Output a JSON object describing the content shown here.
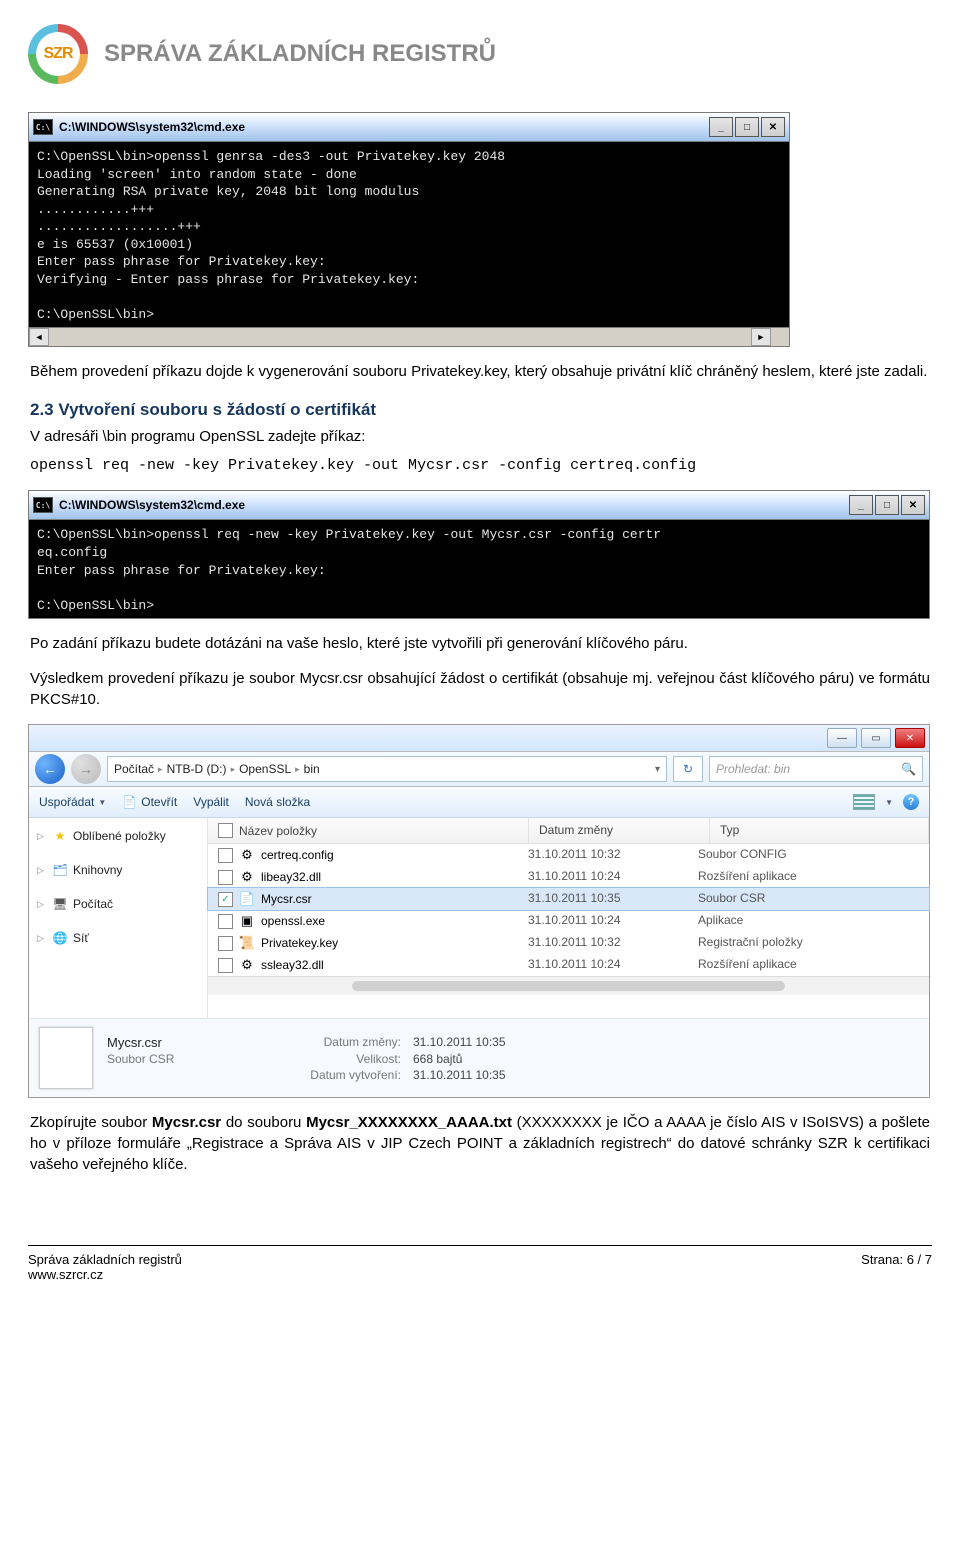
{
  "header": {
    "logo_text": "SZR",
    "title": "SPRÁVA ZÁKLADNÍCH REGISTRŮ"
  },
  "cmd1": {
    "title": "C:\\WINDOWS\\system32\\cmd.exe",
    "icon_label": "C:\\",
    "body": "C:\\OpenSSL\\bin>openssl genrsa -des3 -out Privatekey.key 2048\nLoading 'screen' into random state - done\nGenerating RSA private key, 2048 bit long modulus\n............+++\n..................+++\ne is 65537 (0x10001)\nEnter pass phrase for Privatekey.key:\nVerifying - Enter pass phrase for Privatekey.key:\n\nC:\\OpenSSL\\bin>"
  },
  "para1": "Během provedení příkazu dojde k vygenerování souboru Privatekey.key, který obsahuje privátní klíč chráněný heslem, které jste zadali.",
  "section23": {
    "heading": "2.3 Vytvoření souboru s žádostí o certifikát",
    "line1": "V adresáři \\bin programu OpenSSL zadejte příkaz:",
    "cmdline": "openssl req -new -key Privatekey.key -out Mycsr.csr -config certreq.config"
  },
  "cmd2": {
    "title": "C:\\WINDOWS\\system32\\cmd.exe",
    "icon_label": "C:\\",
    "body": "C:\\OpenSSL\\bin>openssl req -new -key Privatekey.key -out Mycsr.csr -config certr\neq.config\nEnter pass phrase for Privatekey.key:\n\nC:\\OpenSSL\\bin>"
  },
  "para2": "Po zadání příkazu budete dotázáni na vaše heslo, které jste vytvořili při generování klíčového páru.",
  "para3": "Výsledkem provedení příkazu je soubor Mycsr.csr obsahující žádost o certifikát (obsahuje mj. veřejnou část klíčového páru) ve formátu PKCS#10.",
  "explorer": {
    "breadcrumbs": [
      "Počítač",
      "NTB-D (D:)",
      "OpenSSL",
      "bin"
    ],
    "search_placeholder": "Prohledat: bin",
    "toolbar": {
      "organize": "Uspořádat",
      "open": "Otevřít",
      "burn": "Vypálit",
      "newfolder": "Nová složka"
    },
    "sidebar": {
      "favorites": "Oblíbené položky",
      "libraries": "Knihovny",
      "computer": "Počítač",
      "network": "Síť"
    },
    "columns": {
      "name": "Název položky",
      "date": "Datum změny",
      "type": "Typ"
    },
    "rows": [
      {
        "name": "certreq.config",
        "date": "31.10.2011 10:32",
        "type": "Soubor CONFIG",
        "icon": "⚙",
        "selected": false
      },
      {
        "name": "libeay32.dll",
        "date": "31.10.2011 10:24",
        "type": "Rozšíření aplikace",
        "icon": "⚙",
        "selected": false
      },
      {
        "name": "Mycsr.csr",
        "date": "31.10.2011 10:35",
        "type": "Soubor CSR",
        "icon": "📄",
        "selected": true
      },
      {
        "name": "openssl.exe",
        "date": "31.10.2011 10:24",
        "type": "Aplikace",
        "icon": "▣",
        "selected": false
      },
      {
        "name": "Privatekey.key",
        "date": "31.10.2011 10:32",
        "type": "Registrační položky",
        "icon": "📜",
        "selected": false
      },
      {
        "name": "ssleay32.dll",
        "date": "31.10.2011 10:24",
        "type": "Rozšíření aplikace",
        "icon": "⚙",
        "selected": false
      }
    ],
    "details": {
      "filename": "Mycsr.csr",
      "filetype": "Soubor CSR",
      "k_modified": "Datum změny:",
      "v_modified": "31.10.2011 10:35",
      "k_size": "Velikost:",
      "v_size": "668 bajtů",
      "k_created": "Datum vytvoření:",
      "v_created": "31.10.2011 10:35"
    }
  },
  "para4_prefix": "Zkopírujte soubor ",
  "para4_file1": "Mycsr.csr",
  "para4_mid": " do souboru ",
  "para4_file2": "Mycsr_XXXXXXXX_AAAA.txt",
  "para4_tail": " (XXXXXXXX je IČO a AAAA je číslo AIS v ISoISVS) a pošlete ho v příloze formuláře „Registrace a Správa AIS v JIP Czech POINT a základních registrech“ do datové schránky SZR k certifikaci vašeho veřejného klíče.",
  "footer": {
    "org": "Správa základních registrů",
    "url": "www.szrcr.cz",
    "page": "Strana: 6 / 7"
  }
}
